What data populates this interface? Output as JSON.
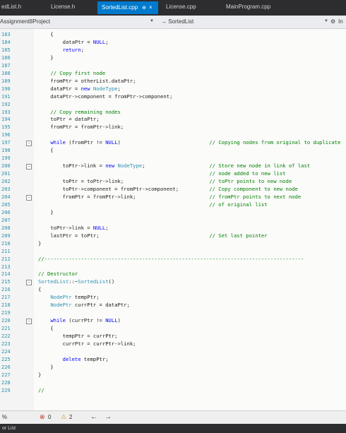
{
  "tabs": [
    {
      "label": "edList.h"
    },
    {
      "label": "License.h"
    },
    {
      "label": "SortedList.cpp",
      "pin": "⊕",
      "close": "×"
    },
    {
      "label": "License.cpp"
    },
    {
      "label": "MainProgram.cpp"
    }
  ],
  "nav": {
    "project": "Assignment8Project",
    "scope": "→ SortedList",
    "right_label": "In"
  },
  "code_lines": [
    {
      "n": "183",
      "t": "    {"
    },
    {
      "n": "184",
      "t": "        dataPtr = NULL;"
    },
    {
      "n": "185",
      "t": "        return;"
    },
    {
      "n": "186",
      "t": "    }"
    },
    {
      "n": "187",
      "t": ""
    },
    {
      "n": "188",
      "t": "    // Copy first node"
    },
    {
      "n": "189",
      "t": "    fromPtr = otherList.dataPtr;"
    },
    {
      "n": "190",
      "t": "    dataPtr = new NodeType;"
    },
    {
      "n": "191",
      "t": "    dataPtr->component = fromPtr->component;"
    },
    {
      "n": "192",
      "t": ""
    },
    {
      "n": "193",
      "t": "    // Copy remaining nodes"
    },
    {
      "n": "194",
      "t": "    toPtr = dataPtr;"
    },
    {
      "n": "195",
      "t": "    fromPtr = fromPtr->link;"
    },
    {
      "n": "196",
      "t": ""
    },
    {
      "n": "197",
      "t": "    while (fromPtr != NULL)                             // Copying nodes from original to duplicate"
    },
    {
      "n": "198",
      "t": "    {"
    },
    {
      "n": "199",
      "t": ""
    },
    {
      "n": "200",
      "t": "        toPtr->link = new NodeType;                     // Store new node in link of last"
    },
    {
      "n": "201",
      "t": "                                                        // node added to new list"
    },
    {
      "n": "202",
      "t": "        toPtr = toPtr->link;                            // toPtr points to new node"
    },
    {
      "n": "203",
      "t": "        toPtr->component = fromPtr->component;          // Copy component to new node"
    },
    {
      "n": "204",
      "t": "        fromPtr = fromPtr->link;                        // fromPtr points to next node"
    },
    {
      "n": "205",
      "t": "                                                        // of original list"
    },
    {
      "n": "206",
      "t": "    }"
    },
    {
      "n": "207",
      "t": ""
    },
    {
      "n": "208",
      "t": "    toPtr->link = NULL;"
    },
    {
      "n": "209",
      "t": "    lastPtr = toPtr;                                    // Set last pointer"
    },
    {
      "n": "210",
      "t": "}"
    },
    {
      "n": "211",
      "t": ""
    },
    {
      "n": "212",
      "t": "//-------------------------------------------------------------------------------------"
    },
    {
      "n": "213",
      "t": ""
    },
    {
      "n": "214",
      "t": "// Destructor"
    },
    {
      "n": "215",
      "t": "SortedList::~SortedList()"
    },
    {
      "n": "216",
      "t": "{"
    },
    {
      "n": "217",
      "t": "    NodePtr tempPtr;"
    },
    {
      "n": "218",
      "t": "    NodePtr currPtr = dataPtr;"
    },
    {
      "n": "219",
      "t": ""
    },
    {
      "n": "220",
      "t": "    while (currPtr != NULL)"
    },
    {
      "n": "221",
      "t": "    {"
    },
    {
      "n": "222",
      "t": "        tempPtr = currPtr;"
    },
    {
      "n": "223",
      "t": "        currPtr = currPtr->link;"
    },
    {
      "n": "224",
      "t": ""
    },
    {
      "n": "225",
      "t": "        delete tempPtr;"
    },
    {
      "n": "226",
      "t": "    }"
    },
    {
      "n": "227",
      "t": "}"
    },
    {
      "n": "228",
      "t": ""
    },
    {
      "n": "229",
      "t": "//"
    }
  ],
  "status": {
    "zoom": "%",
    "errors": "0",
    "warnings": "2",
    "back_arrow": "←",
    "forward_arrow": "→"
  },
  "bottom_panel": {
    "label": "or List"
  },
  "colors": {
    "accent": "#007acc",
    "keyword": "#0000ff",
    "type": "#2b91af",
    "comment": "#008000"
  }
}
